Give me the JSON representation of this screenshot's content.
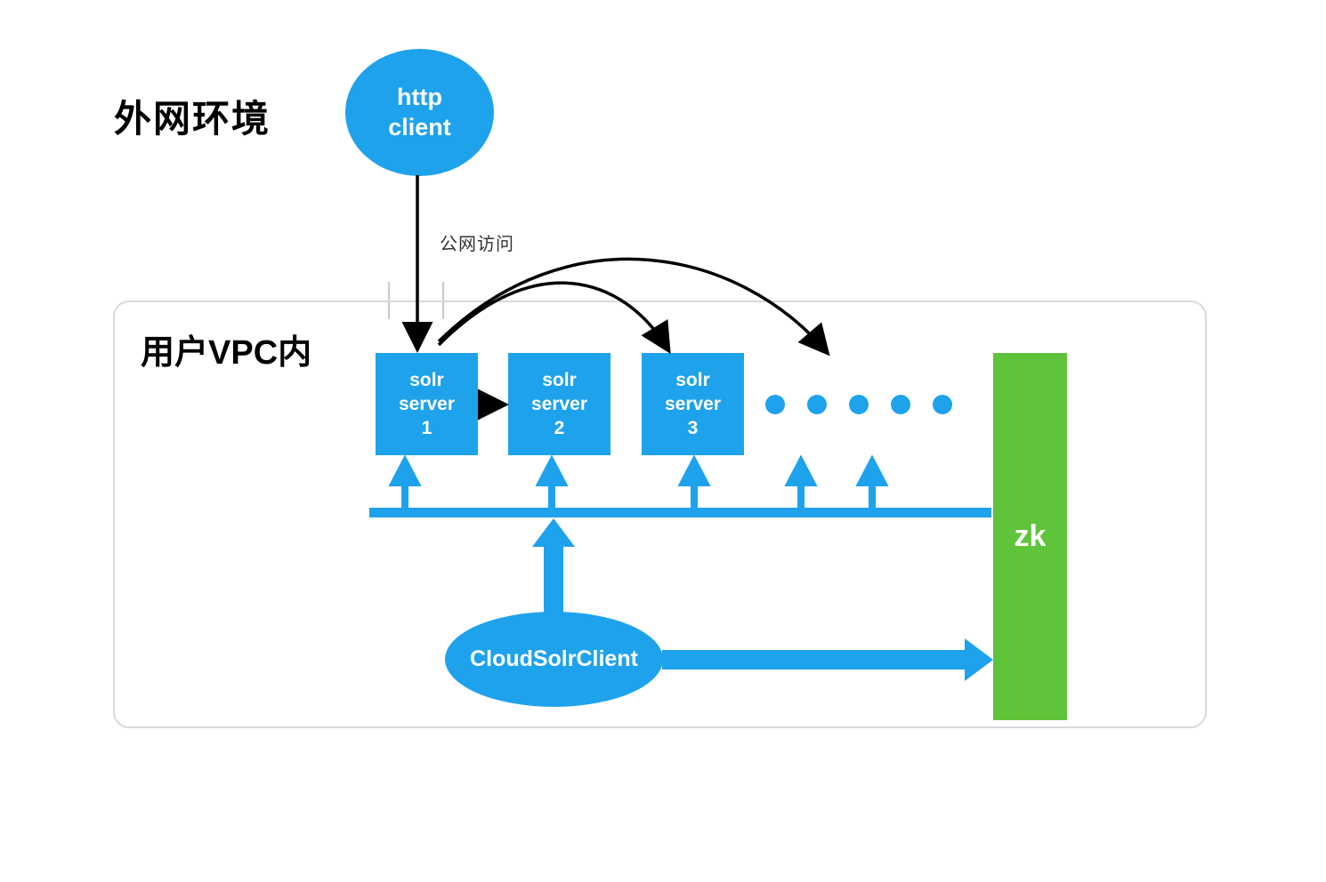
{
  "colors": {
    "blue": "#1ea2ec",
    "green": "#5fc43a",
    "gray": "#c9c9c9",
    "black": "#000000",
    "lightGray": "#d9d9d9"
  },
  "labels": {
    "externalEnv": "外网环境",
    "vpc": "用户VPC内",
    "publicAccess": "公网访问"
  },
  "nodes": {
    "httpClient": "http\nclient",
    "cloudSolrClient": "CloudSolrClient",
    "solr1": "solr\nserver\n1",
    "solr2": "solr\nserver\n2",
    "solr3": "solr\nserver\n3",
    "zk": "zk"
  },
  "ellipsisDots": 5
}
